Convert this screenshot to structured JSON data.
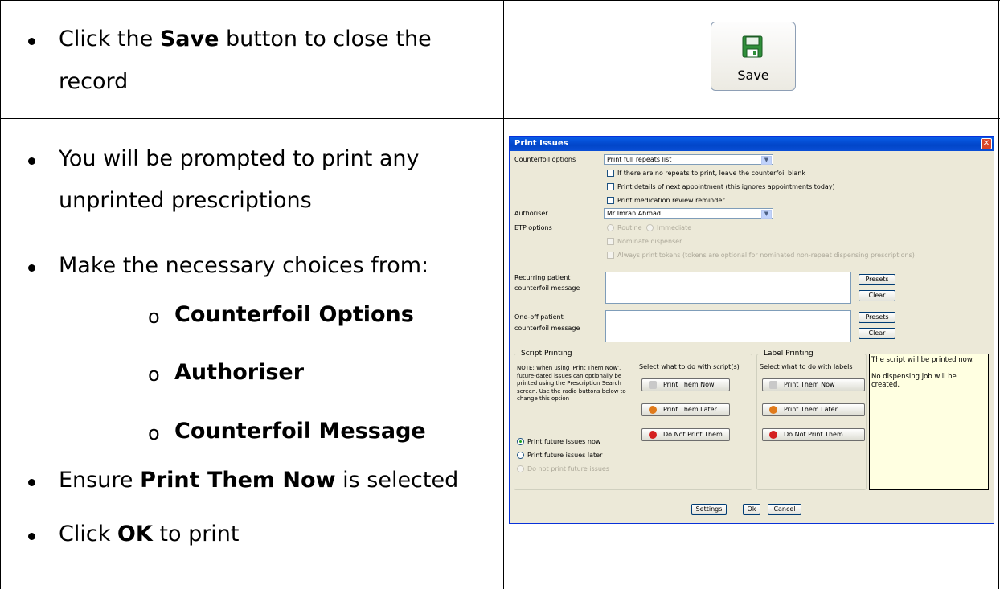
{
  "row1": {
    "text_before": "Click the ",
    "bold": "Save",
    "text_after": " button to close the",
    "line2": "record",
    "save_button_label": "Save"
  },
  "row2": {
    "bullet1_line1": "You will be prompted to print any",
    "bullet1_line2": "unprinted prescriptions",
    "bullet2": "Make the necessary choices from:",
    "sub1": "Counterfoil Options",
    "sub2": "Authoriser",
    "sub3": "Counterfoil Message",
    "bullet3_before": "Ensure ",
    "bullet3_bold": "Print Them Now",
    "bullet3_after": " is selected",
    "bullet4_before": "Click ",
    "bullet4_bold": "OK",
    "bullet4_after": " to print"
  },
  "dialog": {
    "title": "Print Issues",
    "counterfoil_label": "Counterfoil options",
    "counterfoil_value": "Print full repeats list",
    "cb1": "If there are no repeats to print, leave the counterfoil blank",
    "cb2": "Print details of next appointment (this ignores appointments today)",
    "cb3": "Print medication review reminder",
    "authoriser_label": "Authoriser",
    "authoriser_value": "Mr Imran Ahmad",
    "etp_label": "ETP options",
    "etp_routine": "Routine",
    "etp_immediate": "Immediate",
    "etp_nominate": "Nominate dispenser",
    "etp_tokens": "Always print tokens (tokens are optional for nominated non-repeat dispensing prescriptions)",
    "recurring_l1": "Recurring patient",
    "recurring_l2": "counterfoil message",
    "oneoff_l1": "One-off patient",
    "oneoff_l2": "counterfoil message",
    "presets": "Presets",
    "clear": "Clear",
    "script_group": "Script Printing",
    "script_note": "NOTE: When using 'Print Them Now', future-dated issues can optionally be printed using the Prescription Search screen. Use the radio buttons below to change this option",
    "radio_now": "Print future issues now",
    "radio_later": "Print future issues later",
    "radio_not": "Do not print future issues",
    "select_script": "Select what to do with script(s)",
    "label_group": "Label Printing",
    "select_labels": "Select what to do with labels",
    "print_now": "Print Them Now",
    "print_later": "Print Them Later",
    "do_not_print": "Do Not Print Them",
    "info_line1": "The script will be printed now.",
    "info_line2": "No dispensing job will be created.",
    "settings": "Settings",
    "ok": "Ok",
    "cancel": "Cancel"
  }
}
